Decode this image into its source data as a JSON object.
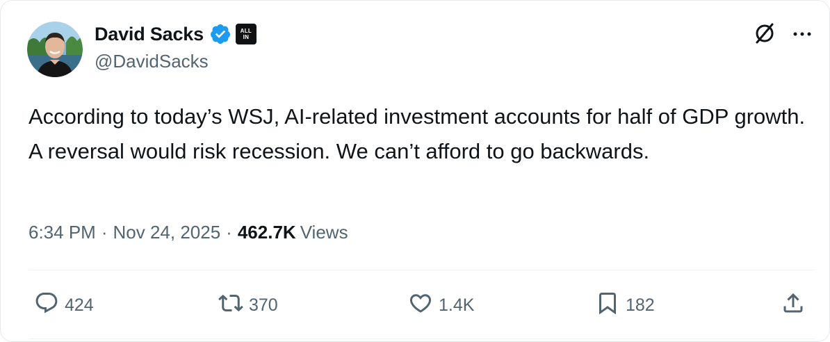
{
  "author": {
    "display_name": "David Sacks",
    "handle": "@DavidSacks",
    "affiliation_badge": "ALL IN",
    "verified_color": "#1d9bf0"
  },
  "tweet": {
    "text": "According to today’s WSJ, AI-related investment accounts for half of GDP growth. A reversal would risk recession. We can’t afford to go backwards.",
    "time": "6:34 PM",
    "date": "Nov 24, 2025",
    "views_count": "462.7K",
    "views_label": "Views",
    "separator": "·"
  },
  "actions": {
    "replies": "424",
    "reposts": "370",
    "likes": "1.4K",
    "bookmarks": "182"
  },
  "icons": {
    "verified": "verified-badge-icon",
    "x_logo": "x-logo-icon",
    "more": "more-icon",
    "reply": "reply-icon",
    "repost": "repost-icon",
    "like": "heart-icon",
    "bookmark": "bookmark-icon",
    "share": "share-icon"
  }
}
